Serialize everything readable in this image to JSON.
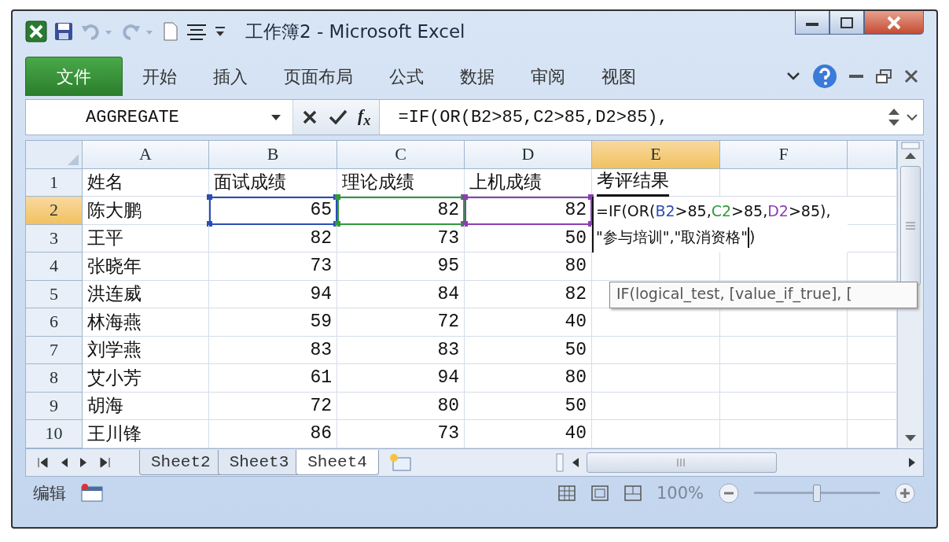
{
  "window": {
    "title": "工作簿2 - Microsoft Excel"
  },
  "ribbon_tabs": [
    {
      "label": "文件",
      "kind": "file",
      "selected": false
    },
    {
      "label": "开始",
      "kind": "tab",
      "selected": false
    },
    {
      "label": "插入",
      "kind": "tab",
      "selected": false
    },
    {
      "label": "页面布局",
      "kind": "tab",
      "selected": false
    },
    {
      "label": "公式",
      "kind": "tab",
      "selected": false
    },
    {
      "label": "数据",
      "kind": "tab",
      "selected": false
    },
    {
      "label": "审阅",
      "kind": "tab",
      "selected": false
    },
    {
      "label": "视图",
      "kind": "tab",
      "selected": false
    }
  ],
  "formula_bar": {
    "name_box": "AGGREGATE",
    "function_button": "f$_{x}$",
    "formula": "=IF(OR(B2>85,C2>85,D2>85),"
  },
  "spreadsheet": {
    "columns": [
      {
        "label": "A",
        "selected": false
      },
      {
        "label": "B",
        "selected": false
      },
      {
        "label": "C",
        "selected": false
      },
      {
        "label": "D",
        "selected": false
      },
      {
        "label": "E",
        "selected": true
      },
      {
        "label": "F",
        "selected": false
      }
    ],
    "rows": [
      {
        "header": "1",
        "selected": false,
        "cells": [
          {
            "text": "姓名"
          },
          {
            "text": "面试成绩"
          },
          {
            "text": "理论成绩"
          },
          {
            "text": "上机成绩"
          },
          {
            "text": "考评结果"
          }
        ]
      },
      {
        "header": "2",
        "selected": true,
        "cells": [
          {
            "text": "陈大鹏"
          },
          {
            "text": "65",
            "color": "#2b4db5"
          },
          {
            "text": "82",
            "color": "#2f9a3a"
          },
          {
            "text": "82",
            "color": "#8a3fb3"
          },
          {
            "editing": true
          }
        ]
      },
      {
        "header": "3",
        "selected": false,
        "cells": [
          {
            "text": "王平"
          },
          {
            "text": "82"
          },
          {
            "text": "73"
          },
          {
            "text": "50"
          }
        ]
      },
      {
        "header": "4",
        "selected": false,
        "cells": [
          {
            "text": "张晓年"
          },
          {
            "text": "73"
          },
          {
            "text": "95"
          },
          {
            "text": "80"
          }
        ]
      },
      {
        "header": "5",
        "selected": false,
        "cells": [
          {
            "text": "洪连威"
          },
          {
            "text": "94"
          },
          {
            "text": "84"
          },
          {
            "text": "82"
          }
        ]
      },
      {
        "header": "6",
        "selected": false,
        "cells": [
          {
            "text": "林海燕"
          },
          {
            "text": "59"
          },
          {
            "text": "72"
          },
          {
            "text": "40"
          }
        ]
      },
      {
        "header": "7",
        "selected": false,
        "cells": [
          {
            "text": "刘学燕"
          },
          {
            "text": "83"
          },
          {
            "text": "83"
          },
          {
            "text": "50"
          }
        ]
      },
      {
        "header": "8",
        "selected": false,
        "cells": [
          {
            "text": "艾小芳"
          },
          {
            "text": "61"
          },
          {
            "text": "94"
          },
          {
            "text": "80"
          }
        ]
      },
      {
        "header": "9",
        "selected": false,
        "cells": [
          {
            "text": "胡海"
          },
          {
            "text": "72"
          },
          {
            "text": "80"
          },
          {
            "text": "50"
          }
        ]
      },
      {
        "header": "10",
        "selected": false,
        "cells": [
          {
            "text": "王川锋"
          },
          {
            "text": "86"
          },
          {
            "text": "73"
          },
          {
            "text": "40"
          }
        ]
      }
    ],
    "cell_editor": {
      "lines": [
        [
          {
            "text": "=IF(OR("
          },
          {
            "text": "B2",
            "color": "#2b4db5"
          },
          {
            "text": ">85,"
          },
          {
            "text": "C2",
            "color": "#2f9a3a"
          },
          {
            "text": ">85,"
          },
          {
            "text": "D2",
            "color": "#8a3fb3"
          },
          {
            "text": ">85),"
          }
        ],
        [
          {
            "text": "\"参与培训\",\"取消资格\""
          },
          {
            "text": ")",
            "caret_before": true
          }
        ]
      ]
    },
    "tooltip": "IF(logical_test, [value_if_true], ["
  },
  "sheet_tabs": [
    {
      "label": "Sheet2",
      "selected": false
    },
    {
      "label": "Sheet3",
      "selected": false
    },
    {
      "label": "Sheet4",
      "selected": true
    }
  ],
  "status_bar": {
    "mode": "编辑",
    "zoom": "100%",
    "zoom_slider": {
      "level": 0.5
    }
  }
}
